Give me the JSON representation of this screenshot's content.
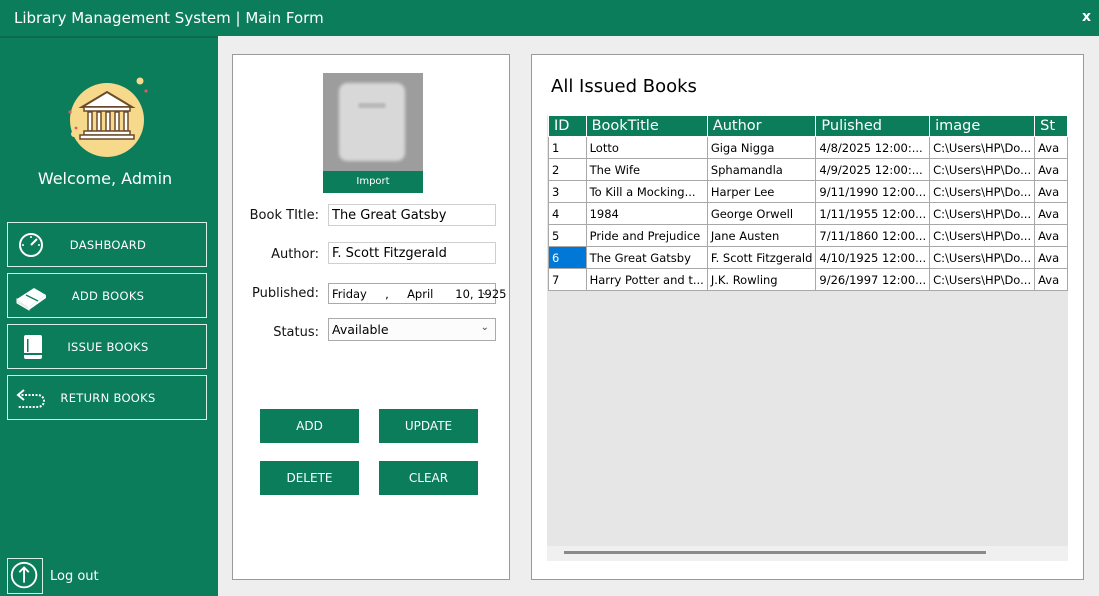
{
  "window": {
    "title": "Library Management System | Main Form",
    "close_label": "x"
  },
  "sidebar": {
    "welcome": "Welcome, Admin",
    "nav": [
      {
        "label": "DASHBOARD",
        "icon": "speedometer-icon"
      },
      {
        "label": "ADD BOOKS",
        "icon": "book-stack-icon"
      },
      {
        "label": "ISSUE BOOKS",
        "icon": "book-icon"
      },
      {
        "label": "RETURN BOOKS",
        "icon": "return-arrow-icon"
      }
    ],
    "logout_label": "Log out"
  },
  "form": {
    "import_label": "Import",
    "book_title_label": "Book TItle:",
    "book_title_value": "The Great Gatsby",
    "author_label": "Author:",
    "author_value": "F. Scott Fitzgerald",
    "published_label": "Published:",
    "published_value": "Friday     ,     April      10, 1925",
    "status_label": "Status:",
    "status_value": "Available",
    "buttons": {
      "add": "ADD",
      "update": "UPDATE",
      "delete": "DELETE",
      "clear": "CLEAR"
    }
  },
  "table": {
    "title": "All Issued Books",
    "columns": [
      "ID",
      "BookTitle",
      "Author",
      "Pulished",
      "image",
      "St"
    ],
    "selected_row": 5,
    "rows": [
      [
        "1",
        "Lotto",
        "Giga Nigga",
        "4/8/2025 12:00:...",
        "C:\\Users\\HP\\Do...",
        "Ava"
      ],
      [
        "2",
        "The Wife",
        "Sphamandla",
        "4/9/2025 12:00:...",
        "C:\\Users\\HP\\Do...",
        "Ava"
      ],
      [
        "3",
        "To Kill a Mocking...",
        "Harper Lee",
        "9/11/1990 12:00...",
        "C:\\Users\\HP\\Do...",
        "Ava"
      ],
      [
        "4",
        "1984",
        "George Orwell",
        "1/11/1955 12:00...",
        "C:\\Users\\HP\\Do...",
        "Ava"
      ],
      [
        "5",
        "Pride and Prejudice",
        "Jane Austen",
        "7/11/1860 12:00...",
        "C:\\Users\\HP\\Do...",
        "Ava"
      ],
      [
        "6",
        "The Great Gatsby",
        "F. Scott Fitzgerald",
        "4/10/1925 12:00...",
        "C:\\Users\\HP\\Do...",
        "Ava"
      ],
      [
        "7",
        "Harry Potter and t...",
        "J.K. Rowling",
        "9/26/1997 12:00...",
        "C:\\Users\\HP\\Do...",
        "Ava"
      ]
    ]
  },
  "colors": {
    "primary": "#0b7d5a",
    "selection": "#0078d7",
    "logo_circle": "#f6d98a"
  }
}
